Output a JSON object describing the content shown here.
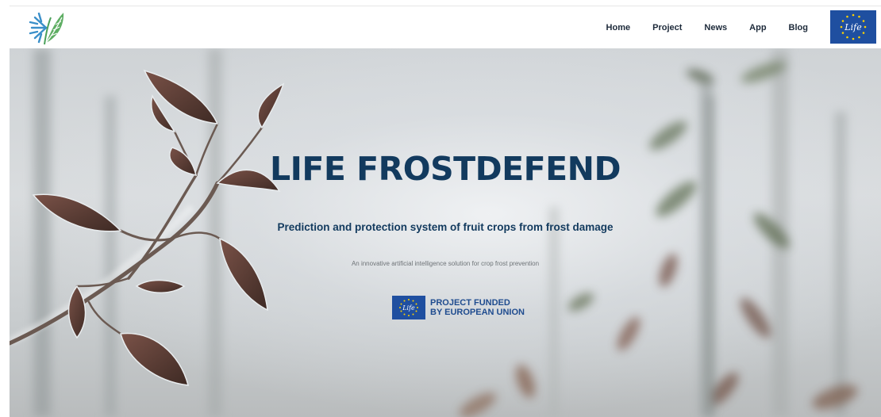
{
  "nav": {
    "items": [
      "Home",
      "Project",
      "News",
      "App",
      "Blog"
    ]
  },
  "brand": {
    "logo_icon": "frost-leaf-logo-icon",
    "eu_badge_text": "Life",
    "colors": {
      "logo_blue": "#3a8fc9",
      "logo_green": "#4aa05a",
      "eu_blue": "#1f4fa0",
      "eu_star": "#ffd200"
    }
  },
  "hero": {
    "title": "LIFE FROSTDEFEND",
    "subtitle": "Prediction and protection system of fruit crops from frost damage",
    "tagline": "An innovative artificial intelligence solution for crop frost prevention",
    "funded_line1": "PROJECT FUNDED",
    "funded_line2": "BY EUROPEAN UNION",
    "title_color": "#123a5e"
  }
}
